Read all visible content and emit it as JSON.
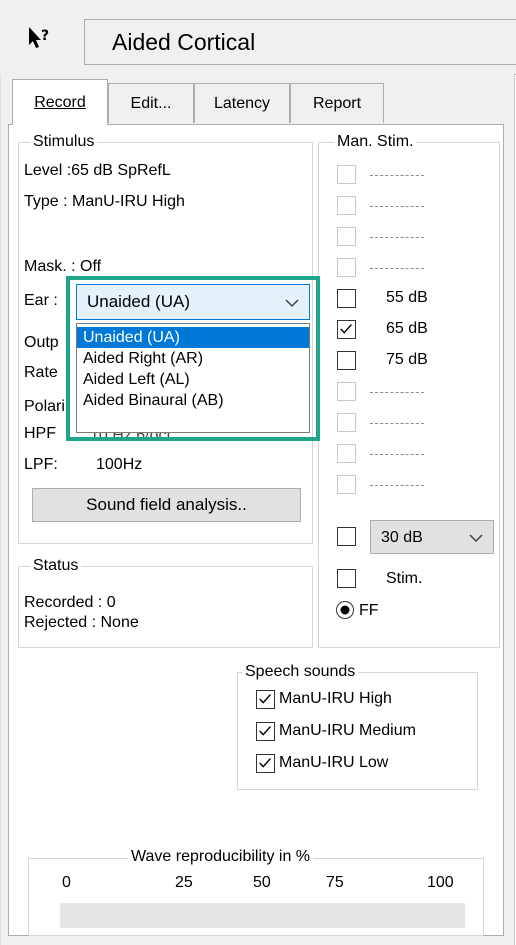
{
  "window": {
    "title": "Aided Cortical"
  },
  "tabs": [
    {
      "label": "Record",
      "active": true
    },
    {
      "label": "Edit..."
    },
    {
      "label": "Latency"
    },
    {
      "label": "Report"
    }
  ],
  "stimulus": {
    "legend": "Stimulus",
    "level": "Level :65 dB SpRefL",
    "type": "Type : ManU-IRU High",
    "mask": "Mask. : Off",
    "ear_label": "Ear :",
    "ear_selected": "Unaided (UA)",
    "ear_options": [
      "Unaided (UA)",
      "Aided Right (AR)",
      "Aided Left (AL)",
      "Aided Binaural (AB)"
    ],
    "output_partial": "Outp",
    "rate_partial": "Rate",
    "polarity_partial": "Polari",
    "hpf_label": "HPF",
    "hpf_partial": "10 Hz 6/oct",
    "lpf_label": "LPF:",
    "lpf_value": "100Hz",
    "sound_field_button": "Sound field analysis.."
  },
  "man_stim": {
    "legend": "Man. Stim.",
    "items": [
      {
        "label": "",
        "enabled": false,
        "checked": false
      },
      {
        "label": "",
        "enabled": false,
        "checked": false
      },
      {
        "label": "",
        "enabled": false,
        "checked": false
      },
      {
        "label": "",
        "enabled": false,
        "checked": false
      },
      {
        "label": "55 dB",
        "enabled": true,
        "checked": false
      },
      {
        "label": "65 dB",
        "enabled": true,
        "checked": true
      },
      {
        "label": "75 dB",
        "enabled": true,
        "checked": false
      },
      {
        "label": "",
        "enabled": false,
        "checked": false
      },
      {
        "label": "",
        "enabled": false,
        "checked": false
      },
      {
        "label": "",
        "enabled": false,
        "checked": false
      },
      {
        "label": "",
        "enabled": false,
        "checked": false
      }
    ],
    "step_combo": "30 dB",
    "stim_label": "Stim.",
    "ff_label": "FF"
  },
  "status": {
    "legend": "Status",
    "recorded": "Recorded :  0",
    "rejected": "Rejected :  None"
  },
  "speech_sounds": {
    "legend": "Speech sounds",
    "items": [
      {
        "label": "ManU-IRU High",
        "checked": true
      },
      {
        "label": "ManU-IRU Medium",
        "checked": true
      },
      {
        "label": "ManU-IRU Low",
        "checked": true
      }
    ]
  },
  "reproducibility": {
    "legend": "Wave reproducibility in %",
    "ticks": [
      "0",
      "25",
      "50",
      "75",
      "100"
    ],
    "value": null
  },
  "colors": {
    "highlight": "#1fa58a",
    "selection": "#0078d7"
  }
}
